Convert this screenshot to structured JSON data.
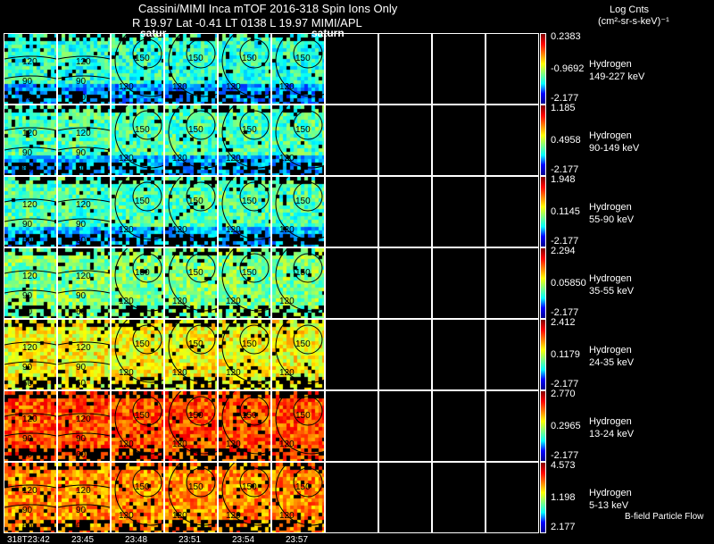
{
  "header": {
    "title": "Cassini/MIMI Inca mTOF  2016-318   Spin   Ions Only",
    "subtitle": "R          19.97 Lat -0.41 LT 0138 L           19.97  MIMI/APL",
    "overlay_left": "satur",
    "overlay_right": "saturn",
    "units_line1": "Log Cnts",
    "units_line2": "(cm²-sr-s-keV)⁻¹"
  },
  "footer": {
    "note": "B-field Particle Flow"
  },
  "chart_data": {
    "type": "heatmap",
    "times": [
      "318T23:42",
      "23:45",
      "23:48",
      "23:51",
      "23:54",
      "23:57"
    ],
    "columns": 10,
    "colormap": "jet",
    "contour_labels": [
      "60",
      "90",
      "120",
      "150",
      "180"
    ],
    "rows": [
      {
        "species": "Hydrogen",
        "energy": "149-227 keV",
        "max": "0.2383",
        "mid": "-0.9692",
        "min": "-2.177"
      },
      {
        "species": "Hydrogen",
        "energy": "90-149 keV",
        "max": "1.185",
        "mid": "0.4958",
        "min": "-2.177"
      },
      {
        "species": "Hydrogen",
        "energy": "55-90 keV",
        "max": "1.948",
        "mid": "0.1145",
        "min": "-2.177"
      },
      {
        "species": "Hydrogen",
        "energy": "35-55 keV",
        "max": "2.294",
        "mid": "0.05850",
        "min": "-2.177"
      },
      {
        "species": "Hydrogen",
        "energy": "24-35 keV",
        "max": "2.412",
        "mid": "0.1179",
        "min": "-2.177"
      },
      {
        "species": "Hydrogen",
        "energy": "13-24 keV",
        "max": "2.770",
        "mid": "0.2965",
        "min": "-2.177"
      },
      {
        "species": "Hydrogen",
        "energy": "5-13 keV",
        "max": "4.573",
        "mid": "1.198",
        "min": "2.177"
      }
    ]
  }
}
